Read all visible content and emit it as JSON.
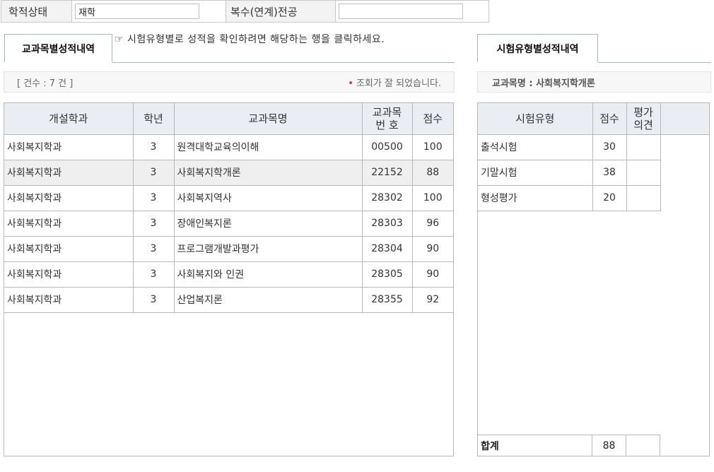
{
  "info": {
    "status_label": "학적상태",
    "status_value": "재학",
    "major_label": "복수(연계)전공",
    "major_value": ""
  },
  "left_tab": {
    "label": "교과목별성적내역"
  },
  "notice": "☞ 시험유형별로 성적을 확인하려면 해당하는 행을 클릭하세요.",
  "left_status": {
    "count": "[ 건수 : 7 건 ]",
    "message": "조회가 잘 되었습니다."
  },
  "courses": {
    "headers": [
      "개설학과",
      "학년",
      "교과목명",
      "교과목 번 호",
      "점수"
    ],
    "rows": [
      [
        "사회복지학과",
        "3",
        "원격대학교육의이해",
        "00500",
        "100"
      ],
      [
        "사회복지학과",
        "3",
        "사회복지학개론",
        "22152",
        "88"
      ],
      [
        "사회복지학과",
        "3",
        "사회복지역사",
        "28302",
        "100"
      ],
      [
        "사회복지학과",
        "3",
        "장애인복지론",
        "28303",
        "96"
      ],
      [
        "사회복지학과",
        "3",
        "프로그램개발과평가",
        "28304",
        "90"
      ],
      [
        "사회복지학과",
        "3",
        "사회복지와 인권",
        "28305",
        "90"
      ],
      [
        "사회복지학과",
        "3",
        "산업복지론",
        "28355",
        "92"
      ]
    ],
    "selected_index": 1
  },
  "right_tab": {
    "label": "시험유형별성적내역"
  },
  "right_status": {
    "course_name": "교과목명 : 사회복지학개론"
  },
  "exams": {
    "headers": [
      "시험유형",
      "점수",
      "평가 의견"
    ],
    "rows": [
      [
        "출석시험",
        "30",
        ""
      ],
      [
        "기말시험",
        "38",
        ""
      ],
      [
        "형성평가",
        "20",
        ""
      ]
    ],
    "total_label": "합계",
    "total_value": "88"
  }
}
